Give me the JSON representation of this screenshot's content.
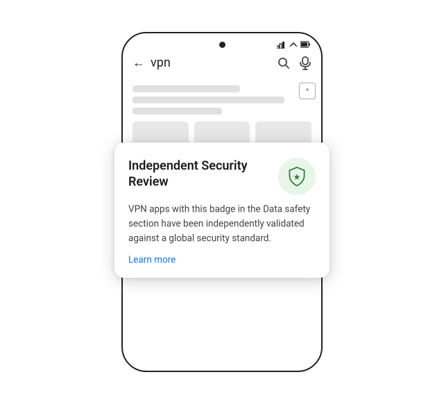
{
  "phone": {
    "search_text": "vpn",
    "back_arrow": "←",
    "camera_alt": "camera"
  },
  "popup": {
    "title": "Independent Security Review",
    "body": "VPN apps with this badge in the Data safety section have been independently validated against a global security standard.",
    "learn_more": "Learn more"
  },
  "icons": {
    "back": "←",
    "search": "🔍",
    "mic": "🎤",
    "scroll_up": "^",
    "signal": "◇▲□"
  },
  "colors": {
    "shield_bg": "#e8f5e9",
    "shield_stroke": "#2e7d32",
    "link": "#1a73e8",
    "text_primary": "#1a1a1a",
    "text_secondary": "#444444"
  }
}
